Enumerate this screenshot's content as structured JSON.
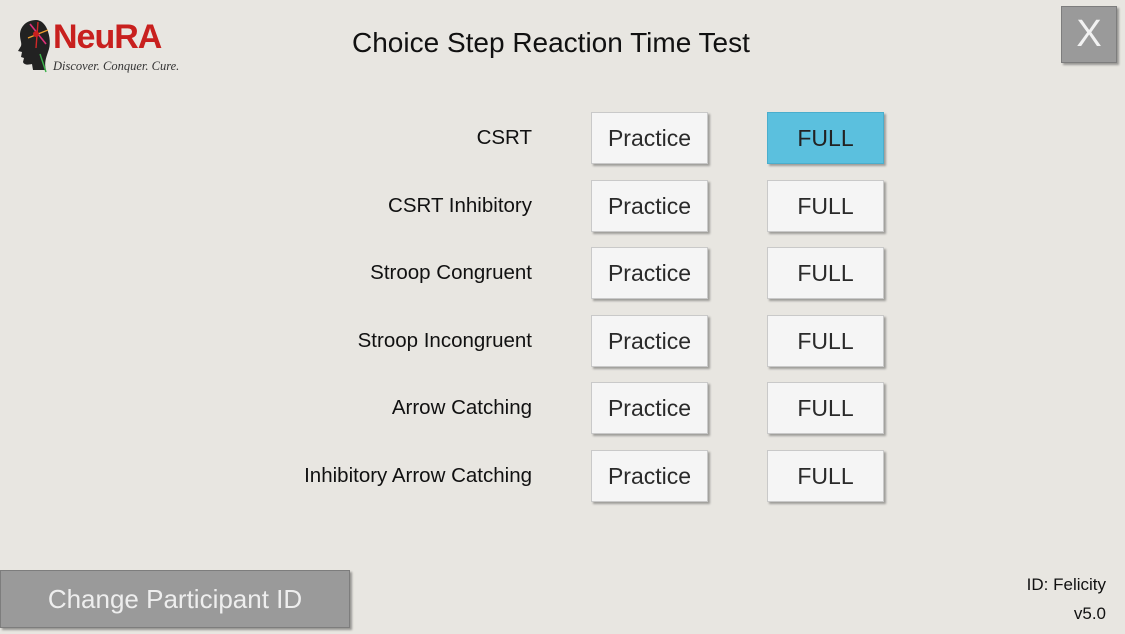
{
  "header": {
    "logo_text": "NeuRA",
    "logo_tagline": "Discover. Conquer. Cure.",
    "title": "Choice Step Reaction Time Test",
    "close_label": "X"
  },
  "tests": [
    {
      "label": "CSRT",
      "practice_label": "Practice",
      "full_label": "FULL",
      "full_selected": true
    },
    {
      "label": "CSRT Inhibitory",
      "practice_label": "Practice",
      "full_label": "FULL",
      "full_selected": false
    },
    {
      "label": "Stroop Congruent",
      "practice_label": "Practice",
      "full_label": "FULL",
      "full_selected": false
    },
    {
      "label": "Stroop Incongruent",
      "practice_label": "Practice",
      "full_label": "FULL",
      "full_selected": false
    },
    {
      "label": "Arrow Catching",
      "practice_label": "Practice",
      "full_label": "FULL",
      "full_selected": false
    },
    {
      "label": "Inhibitory Arrow Catching",
      "practice_label": "Practice",
      "full_label": "FULL",
      "full_selected": false
    }
  ],
  "footer": {
    "change_id_label": "Change Participant ID",
    "participant_id": "ID: Felicity",
    "version": "v5.0"
  },
  "colors": {
    "background": "#e8e6e1",
    "accent_selected": "#5bc0de",
    "brand_red": "#c8201e",
    "secondary_button": "#9a9a9a"
  },
  "icons": {
    "logo": "head-profile-icon",
    "close": "close-icon"
  }
}
